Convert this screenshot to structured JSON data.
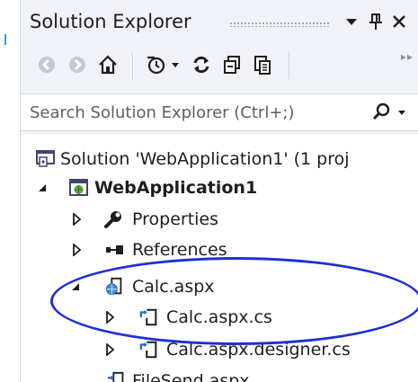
{
  "title_bar": {
    "title": "Solution Explorer",
    "icons": [
      "dropdown-arrow-icon",
      "pin-icon",
      "close-icon"
    ]
  },
  "toolbar": {
    "buttons": [
      "back-icon",
      "forward-icon",
      "home-icon",
      "pending-changes-icon",
      "sync-icon",
      "collapse-all-icon",
      "show-all-files-icon"
    ],
    "overflow": "▸▸"
  },
  "search": {
    "placeholder": "Search Solution Explorer (Ctrl+;)",
    "value": "",
    "icon": "search-icon"
  },
  "tree": {
    "items": [
      {
        "label": "Solution 'WebApplication1' (1 proj",
        "icon": "solution-icon",
        "expander": "none",
        "bold": false
      },
      {
        "label": "WebApplication1",
        "icon": "web-project-icon",
        "expander": "expanded",
        "bold": true
      },
      {
        "label": "Properties",
        "icon": "wrench-icon",
        "expander": "collapsed",
        "bold": false
      },
      {
        "label": "References",
        "icon": "references-icon",
        "expander": "collapsed",
        "bold": false
      },
      {
        "label": "Calc.aspx",
        "icon": "aspx-page-icon",
        "expander": "expanded",
        "bold": false
      },
      {
        "label": "Calc.aspx.cs",
        "icon": "cs-file-icon",
        "expander": "collapsed",
        "bold": false
      },
      {
        "label": "Calc.aspx.designer.cs",
        "icon": "cs-file-icon",
        "expander": "collapsed",
        "bold": false
      },
      {
        "label": "FileSend.aspx",
        "icon": "aspx-page-icon",
        "expander": "none",
        "bold": false
      }
    ]
  },
  "annotation": {
    "shape": "ellipse",
    "color": "#1e2fd6"
  },
  "colors": {
    "panel_bg": "#f1f2f7",
    "tree_bg": "#ffffff",
    "text": "#1e1e1e"
  }
}
